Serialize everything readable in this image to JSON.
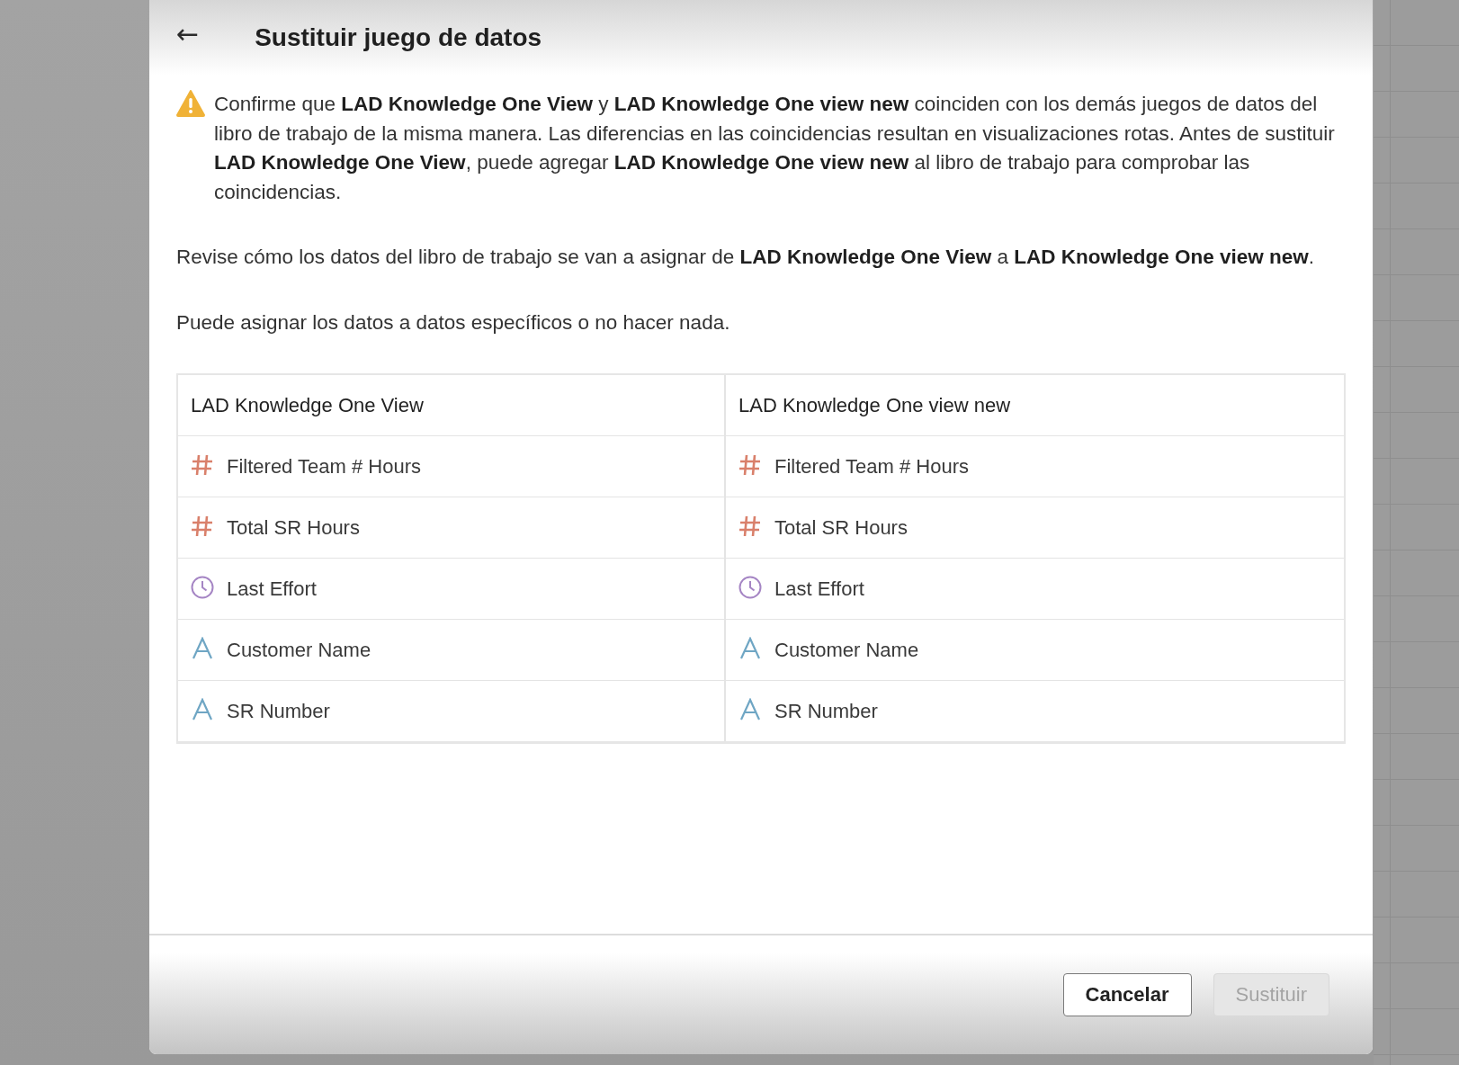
{
  "dialog": {
    "title": "Sustituir juego de datos",
    "back_icon": "←",
    "warning": "Confirme que **LAD Knowledge One View** y **LAD Knowledge One view new** coinciden con los demás juegos de datos del libro de trabajo de la misma manera. Las diferencias en las coincidencias resultan en visualizaciones rotas. Antes de sustituir **LAD Knowledge One View**, puede agregar **LAD Knowledge One view new** al libro de trabajo para comprobar las coincidencias.",
    "paragraphs": [
      "Revise cómo los datos del libro de trabajo se van a asignar de **LAD Knowledge One View** a **LAD Knowledge One view new**.",
      "Puede asignar los datos a datos específicos o no hacer nada."
    ],
    "table": {
      "columns": [
        "LAD Knowledge One View",
        "LAD Knowledge One view new"
      ],
      "rows": [
        {
          "source": {
            "kind": "number",
            "label": "Filtered Team # Hours"
          },
          "target": {
            "kind": "number",
            "label": "Filtered Team # Hours"
          }
        },
        {
          "source": {
            "kind": "number",
            "label": "Total SR Hours"
          },
          "target": {
            "kind": "number",
            "label": "Total SR Hours"
          }
        },
        {
          "source": {
            "kind": "date",
            "label": "Last Effort"
          },
          "target": {
            "kind": "date",
            "label": "Last Effort"
          }
        },
        {
          "source": {
            "kind": "text",
            "label": "Customer Name"
          },
          "target": {
            "kind": "text",
            "label": "Customer Name"
          }
        },
        {
          "source": {
            "kind": "text",
            "label": "SR Number"
          },
          "target": {
            "kind": "text",
            "label": "SR Number"
          }
        }
      ]
    },
    "buttons": [
      {
        "label": "Cancelar",
        "disabled": false
      },
      {
        "label": "Sustituir",
        "disabled": true
      }
    ]
  }
}
